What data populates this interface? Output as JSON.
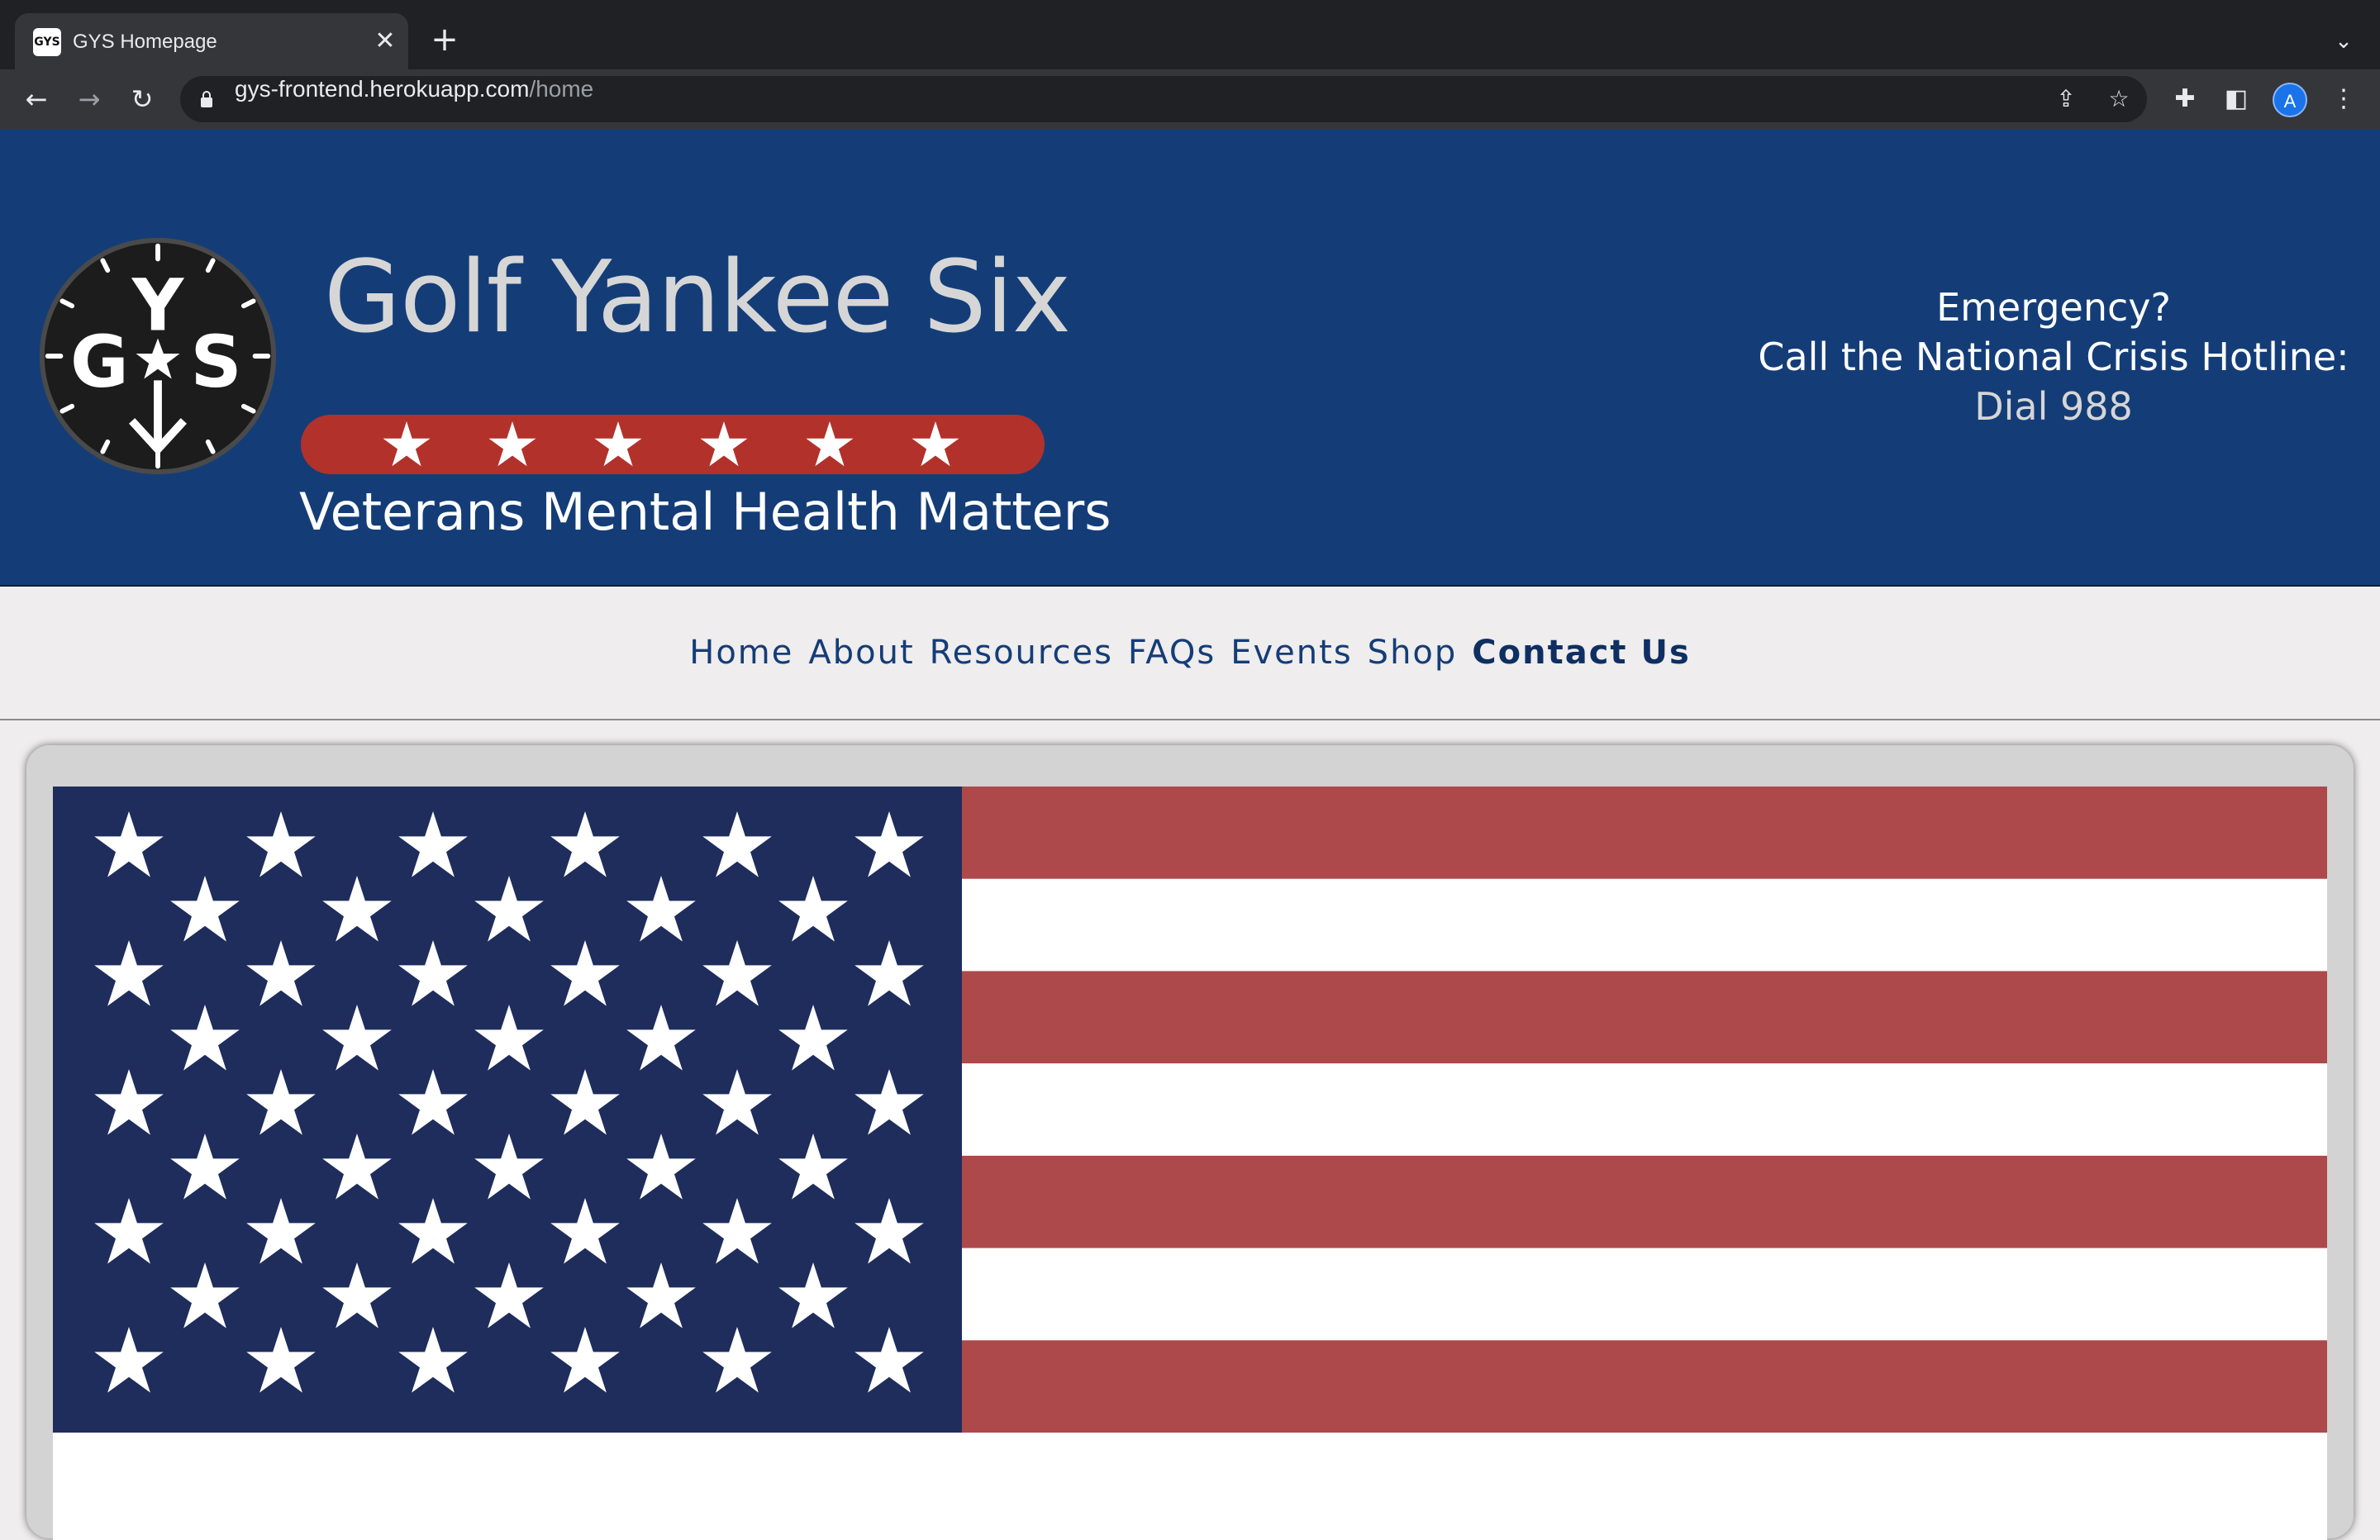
{
  "browser": {
    "tab": {
      "title": "GYS Homepage",
      "favicon": "gys-favicon"
    },
    "address": {
      "domain": "gys-frontend.herokuapp.com",
      "path": "/home"
    },
    "avatar_letter": "A"
  },
  "header": {
    "logo": {
      "letters": "GYS",
      "icon": "gys-clock-logo"
    },
    "title": "Golf Yankee Six",
    "star_count": 6,
    "tagline": "Veterans Mental Health Matters",
    "crisis": {
      "line1": "Emergency?",
      "line2": "Call the National Crisis Hotline:",
      "line3": "Dial 988"
    },
    "colors": {
      "background": "#143d78",
      "star_bar": "#b3312b",
      "title": "#d6d6d6"
    }
  },
  "nav": {
    "items": [
      {
        "label": "Home"
      },
      {
        "label": "About"
      },
      {
        "label": "Resources"
      },
      {
        "label": "FAQs"
      },
      {
        "label": "Events"
      },
      {
        "label": "Shop"
      },
      {
        "label": "Contact Us",
        "active": true
      }
    ]
  },
  "hero": {
    "image": "american-flag",
    "colors": {
      "canton": "#1e2d5c",
      "red_stripe": "#ad484b",
      "white_stripe": "#ffffff"
    }
  }
}
